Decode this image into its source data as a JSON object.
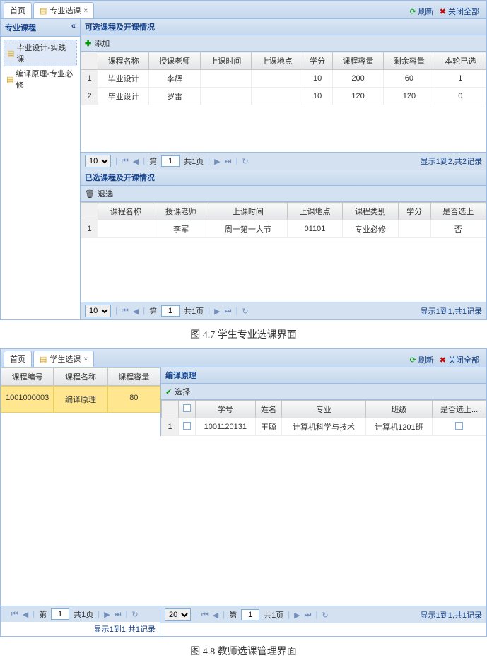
{
  "fig1": {
    "tabs": {
      "home": "首页",
      "t2": "专业选课"
    },
    "toolbar": {
      "refresh": "刷新",
      "closeAll": "关闭全部"
    },
    "sidebar": {
      "title": "专业课程",
      "items": [
        "毕业设计-实践课",
        "编译原理-专业必修"
      ]
    },
    "available": {
      "title": "可选课程及开课情况",
      "add": "添加",
      "cols": [
        "课程名称",
        "授课老师",
        "上课时间",
        "上课地点",
        "学分",
        "课程容量",
        "剩余容量",
        "本轮已选"
      ],
      "rows": [
        {
          "n": "1",
          "name": "毕业设计",
          "teacher": "李辉",
          "time": "",
          "place": "",
          "credit": "10",
          "cap": "200",
          "remain": "60",
          "sel": "1"
        },
        {
          "n": "2",
          "name": "毕业设计",
          "teacher": "罗雷",
          "time": "",
          "place": "",
          "credit": "10",
          "cap": "120",
          "remain": "120",
          "sel": "0"
        }
      ],
      "pg": {
        "size": "10",
        "page": "1",
        "total": "共1页",
        "info": "显示1到2,共2记录"
      }
    },
    "selected": {
      "title": "已选课程及开课情况",
      "drop": "退选",
      "cols": [
        "课程名称",
        "授课老师",
        "上课时间",
        "上课地点",
        "课程类别",
        "学分",
        "是否选上"
      ],
      "rows": [
        {
          "n": "1",
          "name": "",
          "teacher": "李军",
          "time": "周一第一大节",
          "place": "01101",
          "cat": "专业必修",
          "credit": "",
          "sel": "否"
        }
      ],
      "pg": {
        "size": "10",
        "page": "1",
        "total": "共1页",
        "info": "显示1到1,共1记录"
      }
    },
    "caption": "图 4.7  学生专业选课界面"
  },
  "fig2": {
    "tabs": {
      "home": "首页",
      "t2": "学生选课"
    },
    "toolbar": {
      "refresh": "刷新",
      "closeAll": "关闭全部"
    },
    "left": {
      "cols": [
        "课程编号",
        "课程名称",
        "课程容量"
      ],
      "row": {
        "id": "1001000003",
        "name": "编译原理",
        "cap": "80"
      },
      "pg": {
        "page": "1",
        "total": "共1页",
        "info": "显示1到1,共1记录"
      }
    },
    "right": {
      "title": "编译原理",
      "pick": "选择",
      "cols": [
        "学号",
        "姓名",
        "专业",
        "班级",
        "是否选上..."
      ],
      "row": {
        "n": "1",
        "id": "1001120131",
        "name": "王聪",
        "major": "计算机科学与技术",
        "class": "计算机1201班"
      },
      "pg": {
        "size": "20",
        "page": "1",
        "total": "共1页",
        "info": "显示1到1,共1记录"
      }
    },
    "caption": "图 4.8  教师选课管理界面"
  },
  "pgLabel": {
    "di": "第",
    "refresh": "↻"
  }
}
